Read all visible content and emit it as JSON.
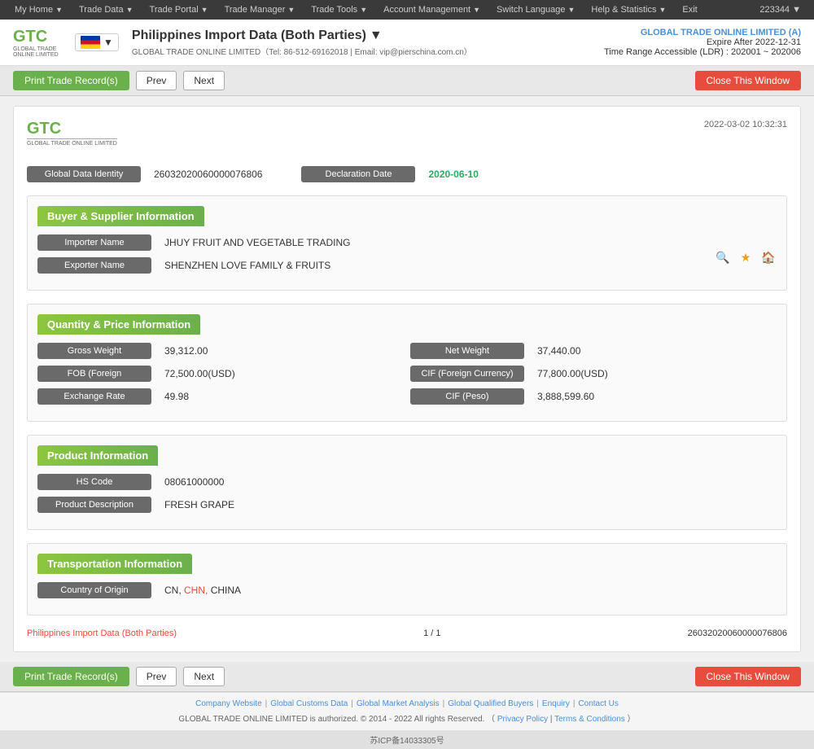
{
  "topnav": {
    "items": [
      {
        "label": "My Home",
        "hasArrow": true
      },
      {
        "label": "Trade Data",
        "hasArrow": true
      },
      {
        "label": "Trade Portal",
        "hasArrow": true
      },
      {
        "label": "Trade Manager",
        "hasArrow": true
      },
      {
        "label": "Trade Tools",
        "hasArrow": true
      },
      {
        "label": "Account Management",
        "hasArrow": true
      },
      {
        "label": "Switch Language",
        "hasArrow": true
      },
      {
        "label": "Help & Statistics",
        "hasArrow": true
      },
      {
        "label": "Exit",
        "hasArrow": false
      }
    ],
    "userId": "223344 ▼"
  },
  "header": {
    "title": "Philippines Import Data (Both Parties)",
    "titleArrow": "▼",
    "subtitle": "GLOBAL TRADE ONLINE LIMITED（Tel: 86-512-69162018 | Email: vip@pierschina.com.cn）",
    "account": {
      "name": "GLOBAL TRADE ONLINE LIMITED (A)",
      "expire": "Expire After 2022-12-31",
      "range": "Time Range Accessible (LDR) : 202001 ~ 202006"
    }
  },
  "toolbar": {
    "print_label": "Print Trade Record(s)",
    "prev_label": "Prev",
    "next_label": "Next",
    "close_label": "Close This Window"
  },
  "record": {
    "timestamp": "2022-03-02 10:32:31",
    "logo_text": "GTC",
    "logo_sub": "GLOBAL TRADE ONLINE LIMITED",
    "global_data_label": "Global Data Identity",
    "global_data_value": "26032020060000076806",
    "declaration_date_label": "Declaration Date",
    "declaration_date_value": "2020-06-10",
    "sections": {
      "buyer_supplier": {
        "title": "Buyer & Supplier Information",
        "importer_label": "Importer Name",
        "importer_value": "JHUY FRUIT AND VEGETABLE TRADING",
        "exporter_label": "Exporter Name",
        "exporter_value": "SHENZHEN LOVE FAMILY & FRUITS"
      },
      "quantity_price": {
        "title": "Quantity & Price Information",
        "gross_weight_label": "Gross Weight",
        "gross_weight_value": "39,312.00",
        "net_weight_label": "Net Weight",
        "net_weight_value": "37,440.00",
        "fob_label": "FOB (Foreign",
        "fob_value": "72,500.00(USD)",
        "cif_foreign_label": "CIF (Foreign Currency)",
        "cif_foreign_value": "77,800.00(USD)",
        "exchange_rate_label": "Exchange Rate",
        "exchange_rate_value": "49.98",
        "cif_peso_label": "CIF (Peso)",
        "cif_peso_value": "3,888,599.60"
      },
      "product": {
        "title": "Product Information",
        "hs_code_label": "HS Code",
        "hs_code_value": "08061000000",
        "product_desc_label": "Product Description",
        "product_desc_value": "FRESH GRAPE"
      },
      "transportation": {
        "title": "Transportation Information",
        "country_origin_label": "Country of Origin",
        "country_origin_cn": "CN,",
        "country_origin_chn": "CHN,",
        "country_origin_china": "CHINA"
      }
    },
    "footer": {
      "title": "Philippines Import Data (Both Parties)",
      "pagination": "1 / 1",
      "record_id": "26032020060000076806"
    }
  },
  "footer": {
    "links": [
      "Company Website",
      "Global Customs Data",
      "Global Market Analysis",
      "Global Qualified Buyers",
      "Enquiry",
      "Contact Us"
    ],
    "copyright": "GLOBAL TRADE ONLINE LIMITED is authorized. © 2014 - 2022 All rights Reserved.",
    "privacy": "Privacy Policy",
    "terms": "Terms & Conditions",
    "icp": "苏ICP备14033305号"
  }
}
